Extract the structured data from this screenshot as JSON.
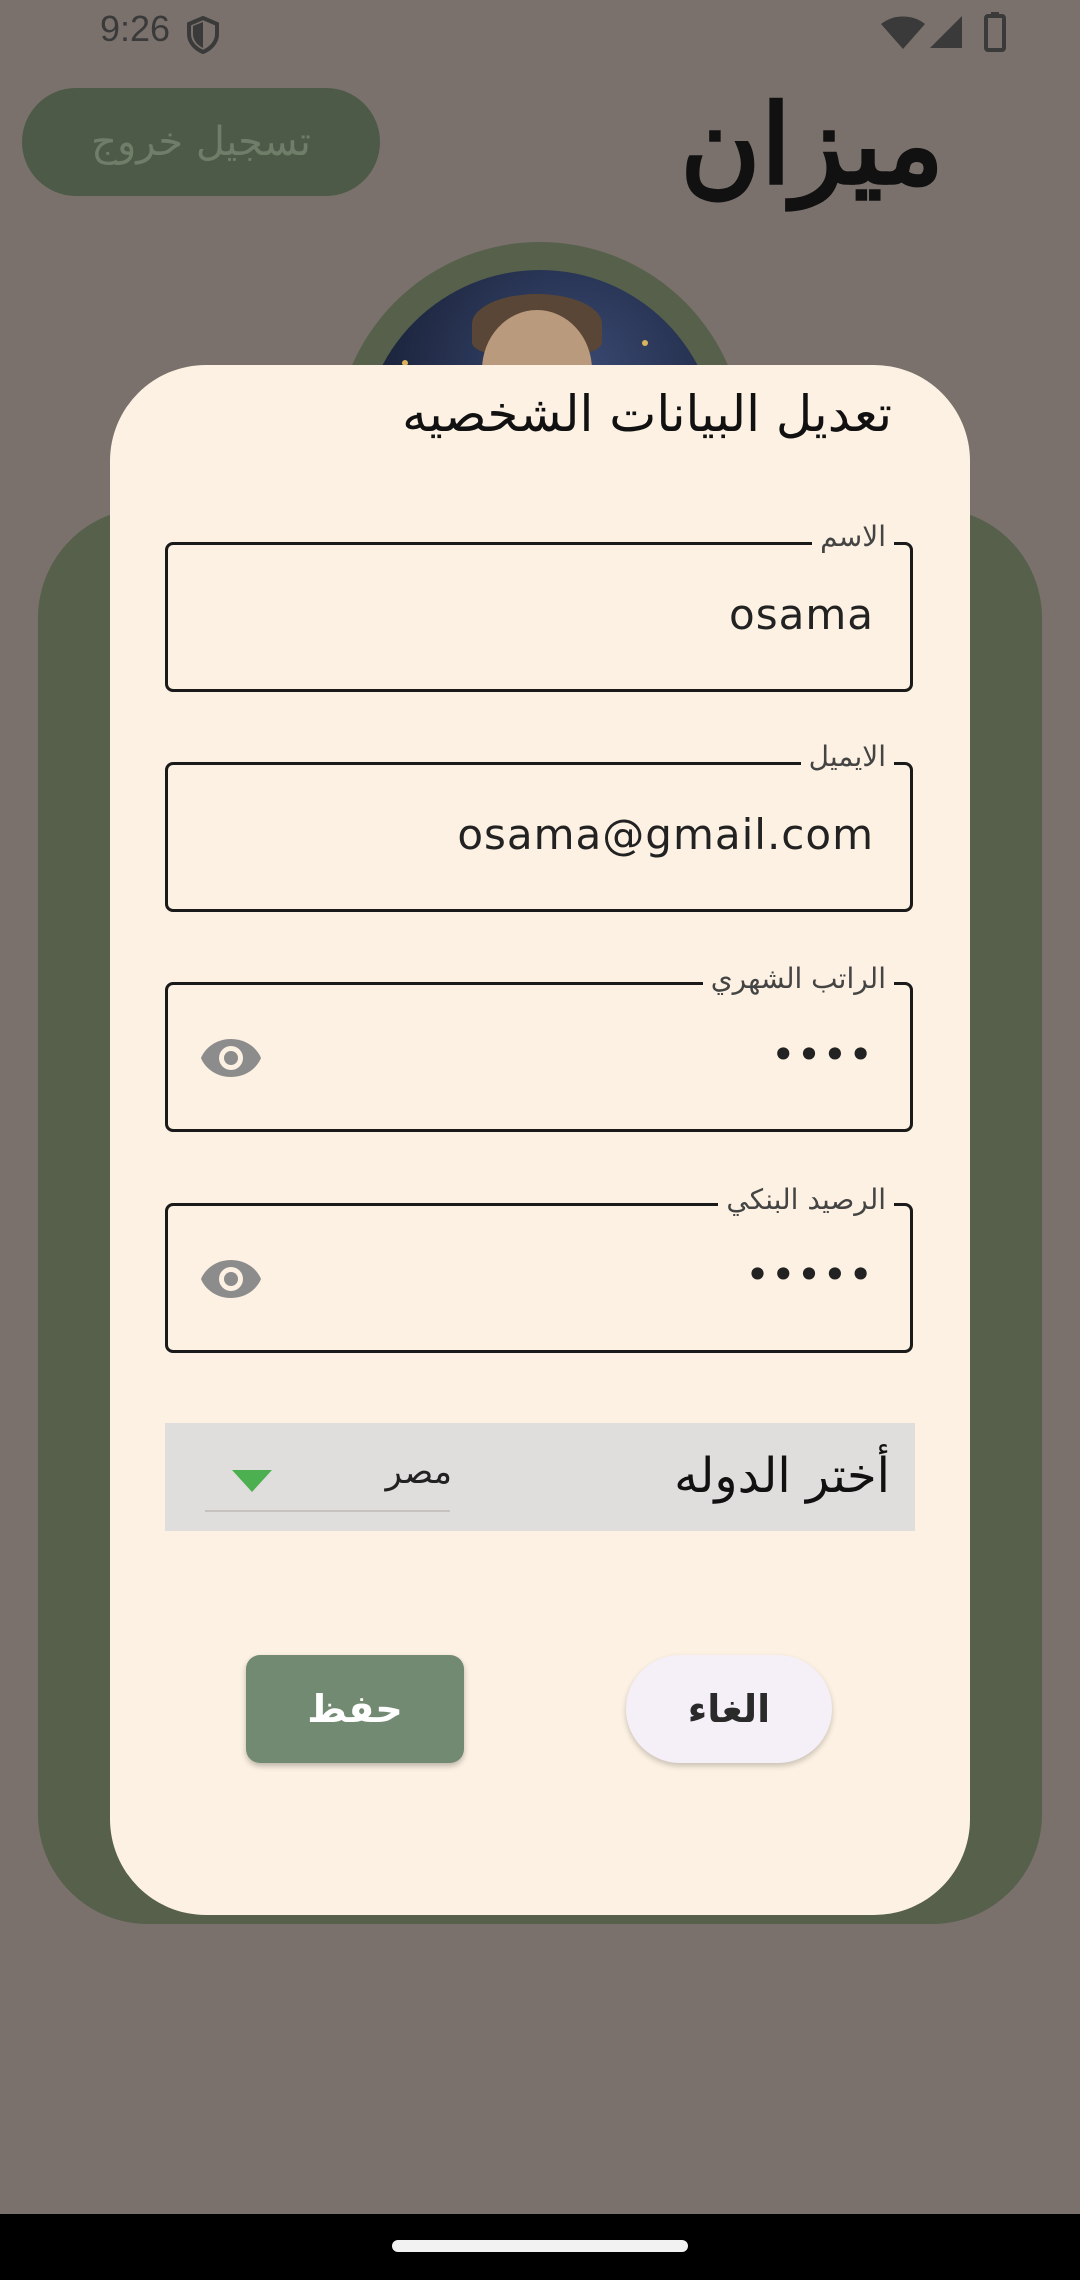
{
  "status_bar": {
    "time": "9:26"
  },
  "header": {
    "logout_label": "تسجيل خروج",
    "app_title": "ميزان"
  },
  "dialog": {
    "title": "تعديل البيانات الشخصيه",
    "fields": [
      {
        "label": "الاسم",
        "value": "osama"
      },
      {
        "label": "الايميل",
        "value": "osama@gmail.com"
      },
      {
        "label": "الراتب الشهري",
        "value": "••••"
      },
      {
        "label": "الرصيد البنكي",
        "value": "•••••"
      }
    ],
    "country": {
      "label": "أختر الدوله",
      "selected": "مصر"
    },
    "save_label": "حفظ",
    "cancel_label": "الغاء"
  },
  "colors": {
    "scrim": "#7a716c",
    "card": "#56604b",
    "dialog": "#fcf1e2",
    "save_button": "#728a71",
    "dropdown_arrow": "#4caf50"
  },
  "icons": {
    "visibility": "eye-icon",
    "dropdown": "chevron-down-icon",
    "vpn": "shield-icon"
  }
}
